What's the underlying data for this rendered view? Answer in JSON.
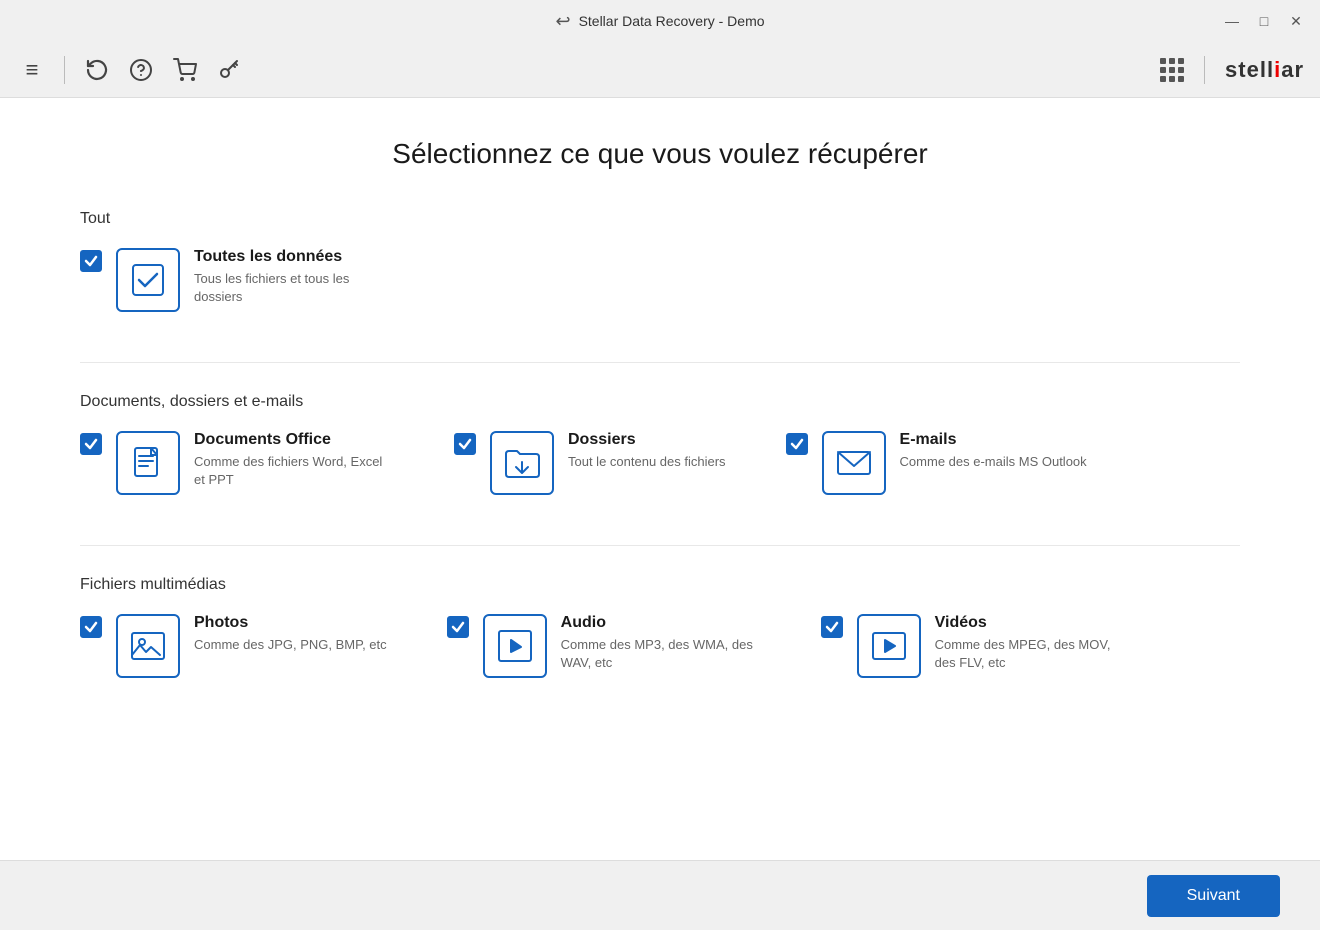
{
  "titleBar": {
    "title": "Stellar Data Recovery - Demo",
    "backIconLabel": "↩",
    "minimizeLabel": "—",
    "maximizeLabel": "□",
    "closeLabel": "✕"
  },
  "toolbar": {
    "menuIcon": "≡",
    "historyIcon": "⟳",
    "helpIcon": "?",
    "cartIcon": "🛒",
    "keyIcon": "🔑",
    "appGridLabel": "app-grid",
    "logoText1": "stell",
    "logoText2": "i",
    "logoText3": "ar"
  },
  "page": {
    "title": "Sélectionnez ce que vous voulez récupérer"
  },
  "sections": [
    {
      "id": "tout",
      "label": "Tout",
      "options": [
        {
          "id": "all-data",
          "title": "Toutes les données",
          "description": "Tous les fichiers et tous les dossiers",
          "checked": true,
          "iconType": "all-data"
        }
      ]
    },
    {
      "id": "documents",
      "label": "Documents, dossiers et e-mails",
      "options": [
        {
          "id": "office-docs",
          "title": "Documents Office",
          "description": "Comme des fichiers Word, Excel et PPT",
          "checked": true,
          "iconType": "document"
        },
        {
          "id": "folders",
          "title": "Dossiers",
          "description": "Tout le contenu des fichiers",
          "checked": true,
          "iconType": "folder"
        },
        {
          "id": "emails",
          "title": "E-mails",
          "description": "Comme des e-mails MS Outlook",
          "checked": true,
          "iconType": "email"
        }
      ]
    },
    {
      "id": "multimedia",
      "label": "Fichiers multimédias",
      "options": [
        {
          "id": "photos",
          "title": "Photos",
          "description": "Comme des JPG, PNG, BMP, etc",
          "checked": true,
          "iconType": "photo"
        },
        {
          "id": "audio",
          "title": "Audio",
          "description": "Comme des MP3, des WMA, des WAV, etc",
          "checked": true,
          "iconType": "audio"
        },
        {
          "id": "videos",
          "title": "Vidéos",
          "description": "Comme des MPEG, des MOV, des FLV, etc",
          "checked": true,
          "iconType": "video"
        }
      ]
    }
  ],
  "footer": {
    "nextButtonLabel": "Suivant"
  }
}
